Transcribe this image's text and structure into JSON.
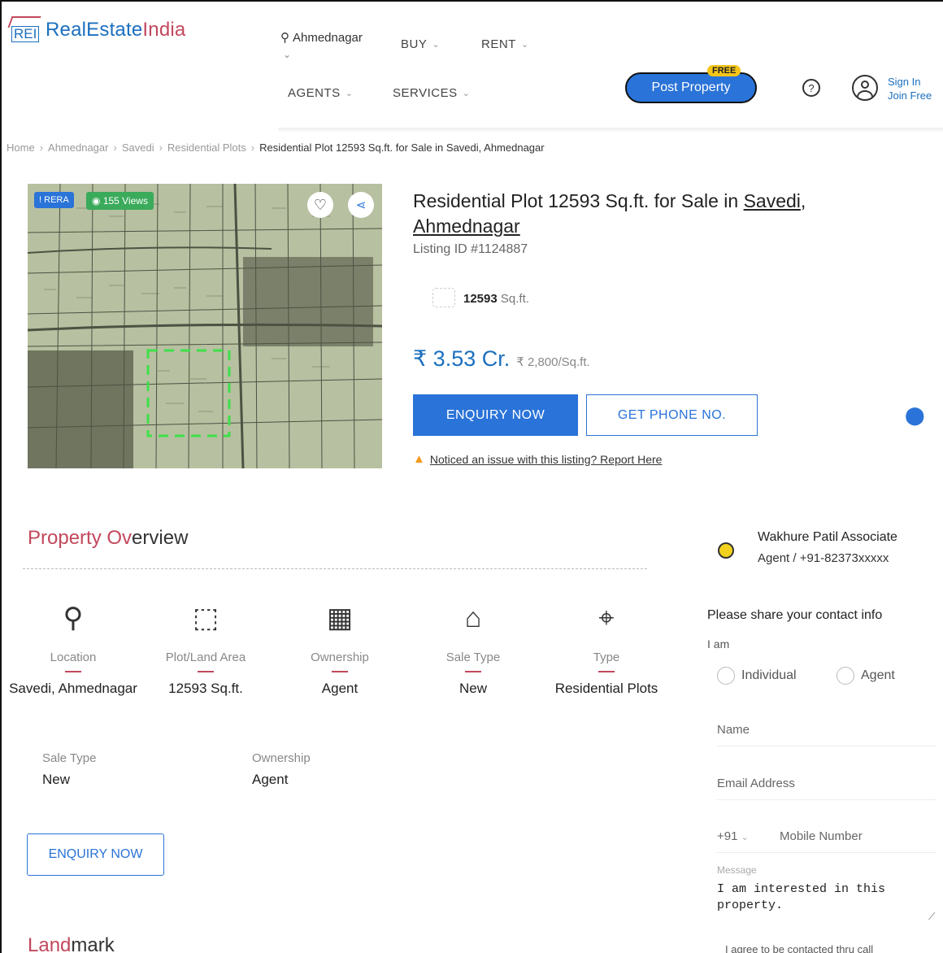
{
  "header": {
    "logo_mark": "REI",
    "logo_text_a": "RealEstate",
    "logo_text_b": "India",
    "location": "Ahmednagar",
    "nav_buy": "BUY",
    "nav_rent": "RENT",
    "nav_agents": "AGENTS",
    "nav_services": "SERVICES",
    "post_property": "Post Property",
    "free_badge": "FREE",
    "sign_in": "Sign In",
    "join_free": "Join Free"
  },
  "breadcrumb": {
    "items": [
      "Home",
      "Ahmednagar",
      "Savedi",
      "Residential Plots"
    ],
    "current": "Residential Plot 12593 Sq.ft. for Sale in Savedi, Ahmednagar"
  },
  "photo": {
    "rera": "RERA",
    "views": "155 Views"
  },
  "listing": {
    "title_prefix": "Residential Plot 12593 Sq.ft. for Sale in ",
    "title_locality": "Savedi",
    "title_city": "Ahmednagar",
    "listing_id": "Listing ID #1124887",
    "area_value": "12593",
    "area_unit": "Sq.ft.",
    "price": "₹ 3.53 Cr.",
    "price_per_unit": "₹ 2,800/Sq.ft.",
    "enquiry_label": "ENQUIRY NOW",
    "phone_label": "GET PHONE NO.",
    "report_text": "Noticed an issue with this listing? Report Here"
  },
  "overview": {
    "title_a": "Property Ov",
    "title_b": "erview",
    "features": [
      {
        "icon": "location-pin-icon",
        "label": "Location",
        "value": "Savedi, Ahmednagar"
      },
      {
        "icon": "plot-area-icon",
        "label": "Plot/Land Area",
        "value": "12593 Sq.ft."
      },
      {
        "icon": "ownership-icon",
        "label": "Ownership",
        "value": "Agent"
      },
      {
        "icon": "sale-type-icon",
        "label": "Sale Type",
        "value": "New"
      },
      {
        "icon": "property-type-icon",
        "label": "Type",
        "value": "Residential Plots"
      }
    ],
    "sale_type_label": "Sale Type",
    "sale_type_value": "New",
    "ownership_label": "Ownership",
    "ownership_value": "Agent",
    "enquiry_label": "ENQUIRY NOW",
    "landmark_a": "Land",
    "landmark_b": "mark"
  },
  "agent": {
    "name": "Wakhure Patil Associate",
    "sub": "Agent / +91-82373xxxxx",
    "prompt": "Please share your contact info",
    "i_am": "I am",
    "opt_individual": "Individual",
    "opt_agent": "Agent",
    "name_placeholder": "Name",
    "email_placeholder": "Email Address",
    "country_code": "+91",
    "mobile_placeholder": "Mobile Number",
    "message_label": "Message",
    "message_value": "I am interested in this property.",
    "agree_text": "I agree to be contacted thru call"
  }
}
